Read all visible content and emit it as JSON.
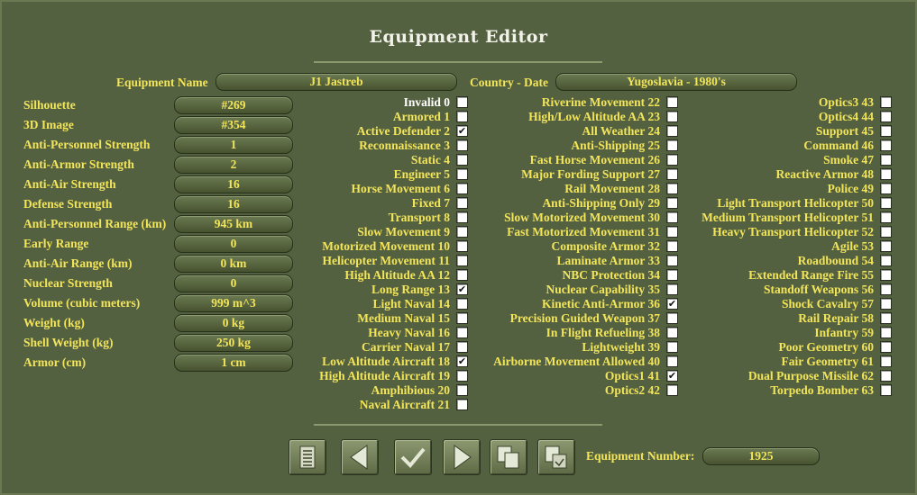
{
  "window": {
    "title": "Equipment Editor"
  },
  "header": {
    "name_label": "Equipment Name",
    "name_value": "J1 Jastreb",
    "country_label": "Country - Date",
    "country_value": "Yugoslavia - 1980's"
  },
  "stats": [
    {
      "label": "Silhouette",
      "value": "#269"
    },
    {
      "label": "3D Image",
      "value": "#354"
    },
    {
      "label": "Anti-Personnel Strength",
      "value": "1"
    },
    {
      "label": "Anti-Armor Strength",
      "value": "2"
    },
    {
      "label": "Anti-Air Strength",
      "value": "16"
    },
    {
      "label": "Defense Strength",
      "value": "16"
    },
    {
      "label": "Anti-Personnel Range (km)",
      "value": "945 km"
    },
    {
      "label": "Early Range",
      "value": "0"
    },
    {
      "label": "Anti-Air Range (km)",
      "value": "0 km"
    },
    {
      "label": "Nuclear Strength",
      "value": "0"
    },
    {
      "label": "Volume (cubic meters)",
      "value": "999 m^3"
    },
    {
      "label": "Weight (kg)",
      "value": "0 kg"
    },
    {
      "label": "Shell Weight (kg)",
      "value": "250 kg"
    },
    {
      "label": "Armor (cm)",
      "value": "1 cm"
    }
  ],
  "flags": [
    {
      "label": "Invalid",
      "num": "0",
      "checked": false
    },
    {
      "label": "Armored",
      "num": "1",
      "checked": false
    },
    {
      "label": "Active Defender",
      "num": "2",
      "checked": true
    },
    {
      "label": "Reconnaissance",
      "num": "3",
      "checked": false
    },
    {
      "label": "Static",
      "num": "4",
      "checked": false
    },
    {
      "label": "Engineer",
      "num": "5",
      "checked": false
    },
    {
      "label": "Horse Movement",
      "num": "6",
      "checked": false
    },
    {
      "label": "Fixed",
      "num": "7",
      "checked": false
    },
    {
      "label": "Transport",
      "num": "8",
      "checked": false
    },
    {
      "label": "Slow Movement",
      "num": "9",
      "checked": false
    },
    {
      "label": "Motorized Movement",
      "num": "10",
      "checked": false
    },
    {
      "label": "Helicopter Movement",
      "num": "11",
      "checked": false
    },
    {
      "label": "High Altitude AA",
      "num": "12",
      "checked": false
    },
    {
      "label": "Long Range",
      "num": "13",
      "checked": true
    },
    {
      "label": "Light Naval",
      "num": "14",
      "checked": false
    },
    {
      "label": "Medium Naval",
      "num": "15",
      "checked": false
    },
    {
      "label": "Heavy Naval",
      "num": "16",
      "checked": false
    },
    {
      "label": "Carrier Naval",
      "num": "17",
      "checked": false
    },
    {
      "label": "Low Altitude Aircraft",
      "num": "18",
      "checked": true
    },
    {
      "label": "High Altitude Aircraft",
      "num": "19",
      "checked": false
    },
    {
      "label": "Amphibious",
      "num": "20",
      "checked": false
    },
    {
      "label": "Naval Aircraft",
      "num": "21",
      "checked": false
    },
    {
      "label": "Riverine Movement",
      "num": "22",
      "checked": false
    },
    {
      "label": "High/Low Altitude AA",
      "num": "23",
      "checked": false
    },
    {
      "label": "All Weather",
      "num": "24",
      "checked": false
    },
    {
      "label": "Anti-Shipping",
      "num": "25",
      "checked": false
    },
    {
      "label": "Fast Horse Movement",
      "num": "26",
      "checked": false
    },
    {
      "label": "Major Fording Support",
      "num": "27",
      "checked": false
    },
    {
      "label": "Rail Movement",
      "num": "28",
      "checked": false
    },
    {
      "label": "Anti-Shipping Only",
      "num": "29",
      "checked": false
    },
    {
      "label": "Slow Motorized Movement",
      "num": "30",
      "checked": false
    },
    {
      "label": "Fast Motorized Movement",
      "num": "31",
      "checked": false
    },
    {
      "label": "Composite Armor",
      "num": "32",
      "checked": false
    },
    {
      "label": "Laminate Armor",
      "num": "33",
      "checked": false
    },
    {
      "label": "NBC Protection",
      "num": "34",
      "checked": false
    },
    {
      "label": "Nuclear Capability",
      "num": "35",
      "checked": false
    },
    {
      "label": "Kinetic Anti-Armor",
      "num": "36",
      "checked": true
    },
    {
      "label": "Precision Guided Weapon",
      "num": "37",
      "checked": false
    },
    {
      "label": "In Flight Refueling",
      "num": "38",
      "checked": false
    },
    {
      "label": "Lightweight",
      "num": "39",
      "checked": false
    },
    {
      "label": "Airborne Movement Allowed",
      "num": "40",
      "checked": false
    },
    {
      "label": "Optics1",
      "num": "41",
      "checked": true
    },
    {
      "label": "Optics2",
      "num": "42",
      "checked": false
    },
    {
      "label": "Optics3",
      "num": "43",
      "checked": false
    },
    {
      "label": "Optics4",
      "num": "44",
      "checked": false
    },
    {
      "label": "Support",
      "num": "45",
      "checked": false
    },
    {
      "label": "Command",
      "num": "46",
      "checked": false
    },
    {
      "label": "Smoke",
      "num": "47",
      "checked": false
    },
    {
      "label": "Reactive Armor",
      "num": "48",
      "checked": false
    },
    {
      "label": "Police",
      "num": "49",
      "checked": false
    },
    {
      "label": "Light Transport Helicopter",
      "num": "50",
      "checked": false
    },
    {
      "label": "Medium Transport Helicopter",
      "num": "51",
      "checked": false
    },
    {
      "label": "Heavy Transport Helicopter",
      "num": "52",
      "checked": false
    },
    {
      "label": "Agile",
      "num": "53",
      "checked": false
    },
    {
      "label": "Roadbound",
      "num": "54",
      "checked": false
    },
    {
      "label": "Extended Range Fire",
      "num": "55",
      "checked": false
    },
    {
      "label": "Standoff Weapons",
      "num": "56",
      "checked": false
    },
    {
      "label": "Shock Cavalry",
      "num": "57",
      "checked": false
    },
    {
      "label": "Rail Repair",
      "num": "58",
      "checked": false
    },
    {
      "label": "Infantry",
      "num": "59",
      "checked": false
    },
    {
      "label": "Poor Geometry",
      "num": "60",
      "checked": false
    },
    {
      "label": "Fair Geometry",
      "num": "61",
      "checked": false
    },
    {
      "label": "Dual Purpose Missile",
      "num": "62",
      "checked": false
    },
    {
      "label": "Torpedo Bomber",
      "num": "63",
      "checked": false
    }
  ],
  "toolbar": {
    "buttons": [
      {
        "name": "list-button",
        "icon": "list-icon"
      },
      {
        "name": "previous-button",
        "icon": "arrow-left-icon"
      },
      {
        "name": "accept-button",
        "icon": "checkmark-icon"
      },
      {
        "name": "next-button",
        "icon": "arrow-right-icon"
      },
      {
        "name": "copy-button",
        "icon": "copy-icon"
      },
      {
        "name": "paste-button",
        "icon": "paste-icon"
      }
    ],
    "number_label": "Equipment Number:",
    "number_value": "1925"
  },
  "colors": {
    "background": "#546141",
    "label_text": "#f2e55a",
    "title_text": "#f2f2ea",
    "invalid_text": "#ffffff"
  }
}
